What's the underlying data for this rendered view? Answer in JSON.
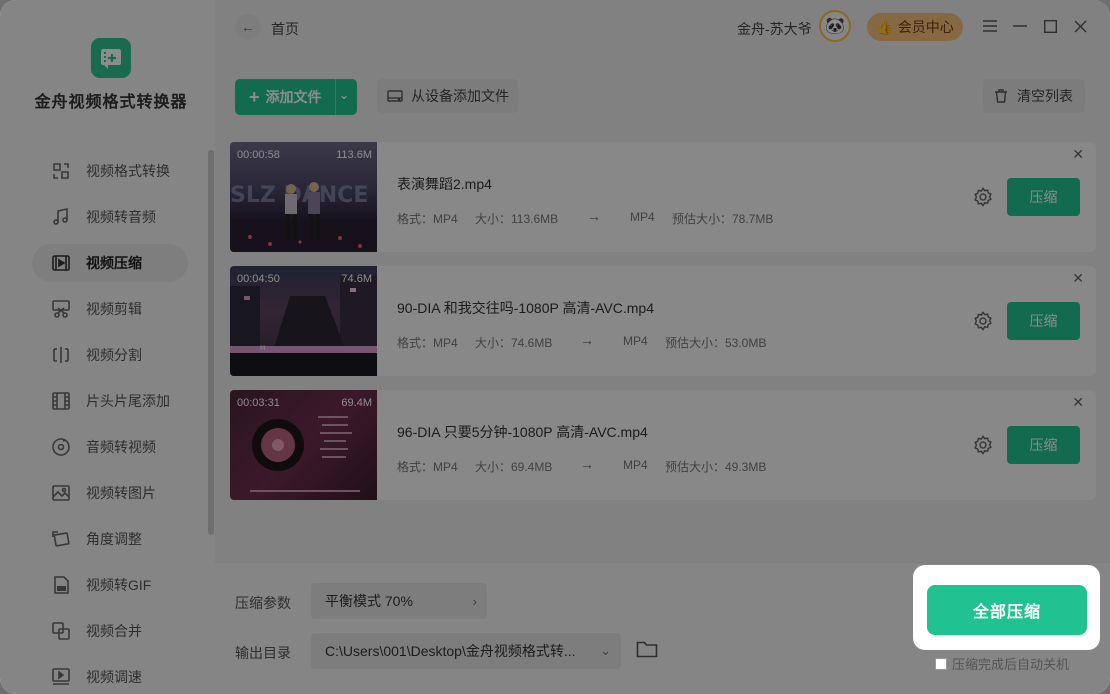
{
  "app": {
    "name": "金舟视频格式转换器",
    "user_name": "金舟-苏大爷",
    "vip_label": "会员中心",
    "breadcrumb": "首页"
  },
  "sidebar": {
    "items": [
      {
        "label": "视频格式转换",
        "icon": "format-convert-icon"
      },
      {
        "label": "视频转音频",
        "icon": "music-note-icon"
      },
      {
        "label": "视频压缩",
        "icon": "video-compress-icon",
        "active": true
      },
      {
        "label": "视频剪辑",
        "icon": "scissors-icon"
      },
      {
        "label": "视频分割",
        "icon": "split-icon"
      },
      {
        "label": "片头片尾添加",
        "icon": "film-strip-icon"
      },
      {
        "label": "音频转视频",
        "icon": "audio-disc-icon"
      },
      {
        "label": "视频转图片",
        "icon": "image-icon"
      },
      {
        "label": "角度调整",
        "icon": "rotate-icon"
      },
      {
        "label": "视频转GIF",
        "icon": "gif-icon"
      },
      {
        "label": "视频合并",
        "icon": "merge-icon"
      },
      {
        "label": "视频调速",
        "icon": "speed-icon"
      }
    ]
  },
  "toolbar": {
    "add_file": "添加文件",
    "add_from_device": "从设备添加文件",
    "clear_list": "清空列表"
  },
  "files": [
    {
      "duration": "00:00:58",
      "size": "113.6M",
      "name": "表演舞蹈2.mp4",
      "format_label": "格式：MP4",
      "size_label": "大小：113.6MB",
      "target_format": "MP4",
      "est_size_label": "预估大小：78.7MB",
      "action": "压缩"
    },
    {
      "duration": "00:04:50",
      "size": "74.6M",
      "name": "90-DIA 和我交往吗-1080P 高清-AVC.mp4",
      "format_label": "格式：MP4",
      "size_label": "大小：74.6MB",
      "target_format": "MP4",
      "est_size_label": "预估大小：53.0MB",
      "action": "压缩"
    },
    {
      "duration": "00:03:31",
      "size": "69.4M",
      "name": "96-DIA 只要5分钟-1080P 高清-AVC.mp4",
      "format_label": "格式：MP4",
      "size_label": "大小：69.4MB",
      "target_format": "MP4",
      "est_size_label": "预估大小：49.3MB",
      "action": "压缩"
    }
  ],
  "bottom": {
    "param_label": "压缩参数",
    "param_value": "平衡模式 70%",
    "output_label": "输出目录",
    "output_value": "C:\\Users\\001\\Desktop\\金舟视频格式转...",
    "compress_all": "全部压缩",
    "auto_shutdown": "压缩完成后自动关机"
  },
  "colors": {
    "accent": "#21c291",
    "vip": "#f4c07a"
  }
}
